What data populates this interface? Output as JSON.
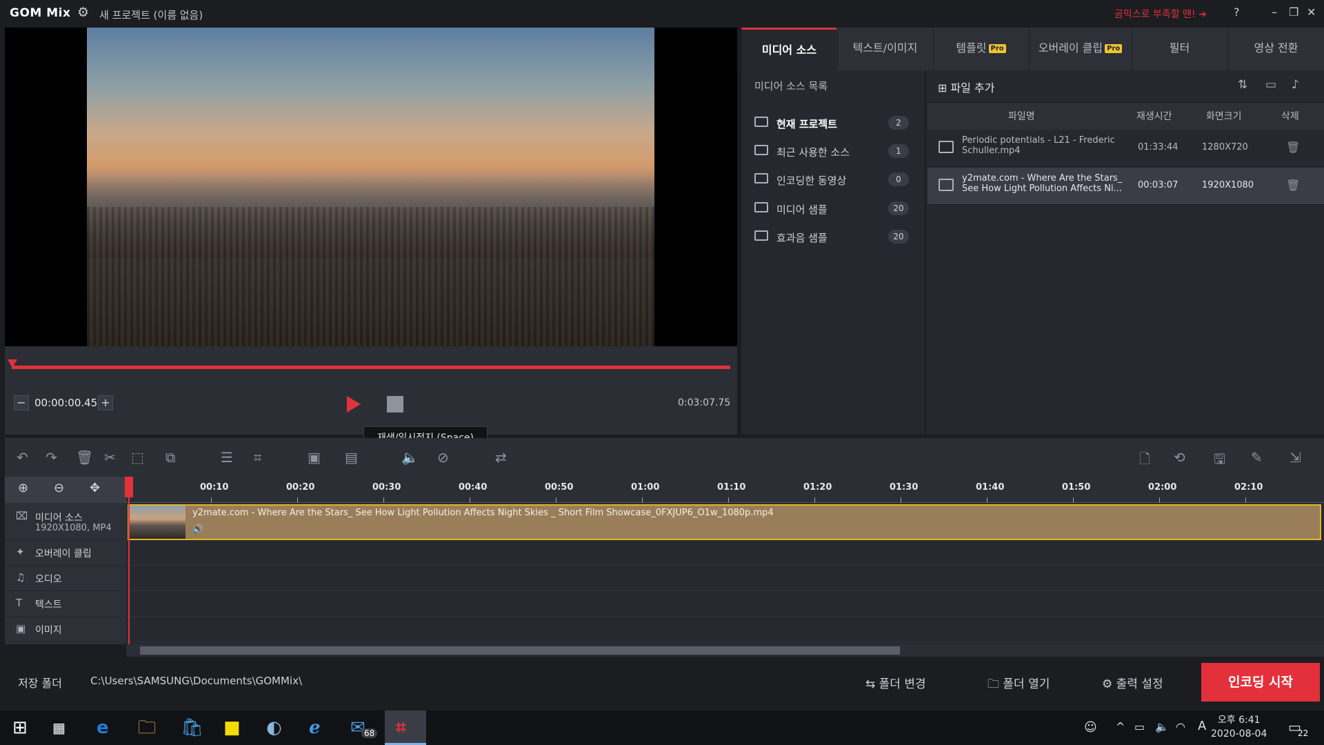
{
  "app": {
    "name": "GOM Mix",
    "project": "새 프로젝트 (이름 없음)",
    "promo": "곰믹스로 부족할 땐! ➔",
    "help": "?"
  },
  "player": {
    "current_time": "00:00:00.45",
    "duration": "0:03:07.75",
    "tooltip": "재생/일시정지 (Space)",
    "progress": 0.0024
  },
  "tabs": [
    {
      "label": "미디어 소스",
      "pro": ""
    },
    {
      "label": "텍스트/이미지",
      "pro": ""
    },
    {
      "label": "템플릿",
      "pro": "Pro"
    },
    {
      "label": "오버레이 클립",
      "pro": "Pro"
    },
    {
      "label": "필터",
      "pro": ""
    },
    {
      "label": "영상 전환",
      "pro": ""
    }
  ],
  "media_source": {
    "list_title": "미디어 소스 목록",
    "items": [
      {
        "label": "현재 프로젝트",
        "count": "2"
      },
      {
        "label": "최근 사용한 소스",
        "count": "1"
      },
      {
        "label": "인코딩한 동영상",
        "count": "0"
      },
      {
        "label": "미디어 샘플",
        "count": "20"
      },
      {
        "label": "효과음 샘플",
        "count": "20"
      }
    ],
    "add_file": "파일 추가",
    "columns": [
      "파일명",
      "재생시간",
      "화면크기",
      "삭제"
    ],
    "files": [
      {
        "name": "Periodic potentials - L21 - Frederic Schuller.mp4",
        "duration": "01:33:44",
        "size": "1280X720"
      },
      {
        "name": "y2mate.com - Where Are the Stars_ See How Light Pollution Affects Ni...",
        "duration": "00:03:07",
        "size": "1920X1080"
      }
    ]
  },
  "timeline": {
    "ticks": [
      "00:10",
      "00:20",
      "00:30",
      "00:40",
      "00:50",
      "01:00",
      "01:10",
      "01:20",
      "01:30",
      "01:40",
      "01:50",
      "02:00",
      "02:10"
    ],
    "tracks": [
      {
        "label": "미디어 소스",
        "sub": "1920X1080, MP4"
      },
      {
        "label": "오버레이 클립",
        "sub": ""
      },
      {
        "label": "오디오",
        "sub": ""
      },
      {
        "label": "텍스트",
        "sub": ""
      },
      {
        "label": "이미지",
        "sub": ""
      }
    ],
    "clip_name": "y2mate.com - Where Are the Stars_ See How Light Pollution Affects Night Skies _ Short Film Showcase_0FXJUP6_O1w_1080p.mp4"
  },
  "bottom": {
    "save_label": "저장 폴더",
    "save_path": "C:\\Users\\SAMSUNG\\Documents\\GOMMix\\",
    "change_folder": "폴더 변경",
    "open_folder": "폴더 열기",
    "output_settings": "출력 설정",
    "start_encoding": "인코딩 시작"
  },
  "taskbar": {
    "mail_badge": "68",
    "time": "오후 6:41",
    "date": "2020-08-04",
    "notif_count": "22",
    "ime": "A"
  },
  "colors": {
    "accent": "#e3313b",
    "clip": "#9a7e5a",
    "clip_border": "#e0b623"
  }
}
